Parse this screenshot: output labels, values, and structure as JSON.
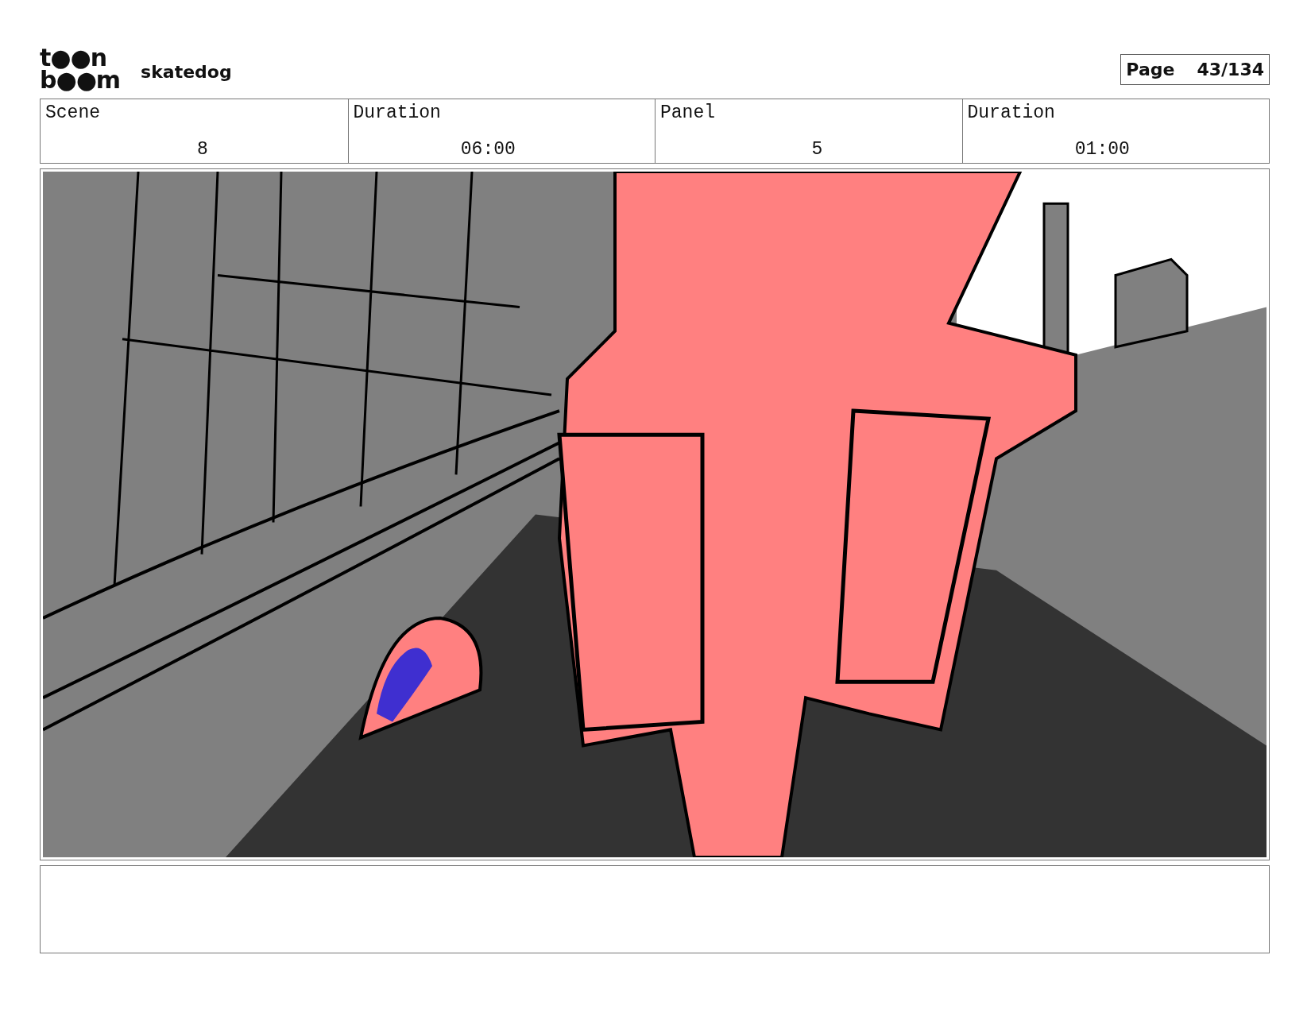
{
  "header": {
    "logo": [
      "t●●n",
      "b●●m"
    ],
    "project": "skatedog",
    "page": {
      "label": "Page",
      "value": "43/134"
    }
  },
  "info": [
    {
      "label": "Scene",
      "value": "8"
    },
    {
      "label": "Duration",
      "value": "06:00"
    },
    {
      "label": "Panel",
      "value": "5"
    },
    {
      "label": "Duration",
      "value": "01:00"
    }
  ]
}
